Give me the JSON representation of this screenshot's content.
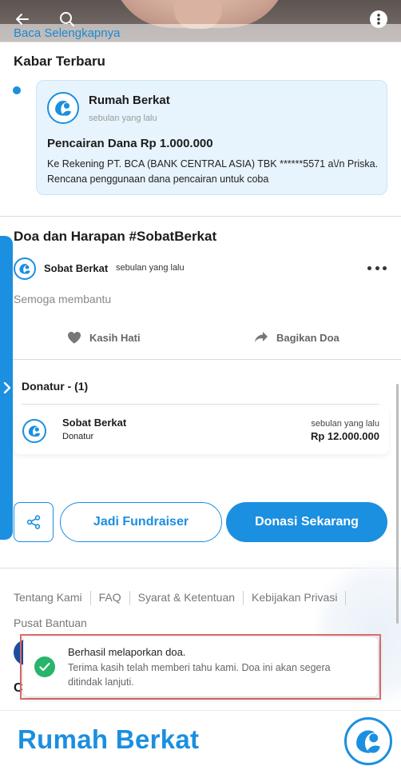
{
  "hero": {
    "read_more": "Baca Selengkapnya"
  },
  "news": {
    "section_title": "Kabar Terbaru",
    "org_name": "Rumah Berkat",
    "time": "sebulan yang lalu",
    "title": "Pencairan Dana Rp 1.000.000",
    "body": "Ke Rekening PT. BCA (BANK CENTRAL ASIA) TBK ******5571 a\\/n Priska. Rencana penggunaan dana pencairan untuk coba"
  },
  "prayer": {
    "section_title": "Doa dan Harapan #SobatBerkat",
    "author": "Sobat Berkat",
    "time": "sebulan yang lalu",
    "text": "Semoga membantu",
    "like_label": "Kasih Hati",
    "share_label": "Bagikan Doa"
  },
  "donatur": {
    "title": "Donatur - (1)",
    "items": [
      {
        "name": "Sobat Berkat",
        "role": "Donatur",
        "time": "sebulan yang lalu",
        "amount": "Rp 12.000.000"
      }
    ]
  },
  "actions": {
    "fundraiser_label": "Jadi Fundraiser",
    "donate_label": "Donasi Sekarang"
  },
  "footer": {
    "links": [
      "Tentang Kami",
      "FAQ",
      "Syarat & Ketentuan",
      "Kebijakan Privasi"
    ],
    "help_link": "Pusat Bantuan",
    "partial_heading": "C"
  },
  "toast": {
    "title": "Berhasil melaporkan doa.",
    "message": "Terima kasih telah memberi tahu kami. Doa ini akan segera ditindak lanjuti."
  },
  "brand": {
    "name": "Rumah Berkat"
  },
  "colors": {
    "primary": "#1b8fe0",
    "success": "#27b56b",
    "card_bg": "#e7f4fd"
  }
}
